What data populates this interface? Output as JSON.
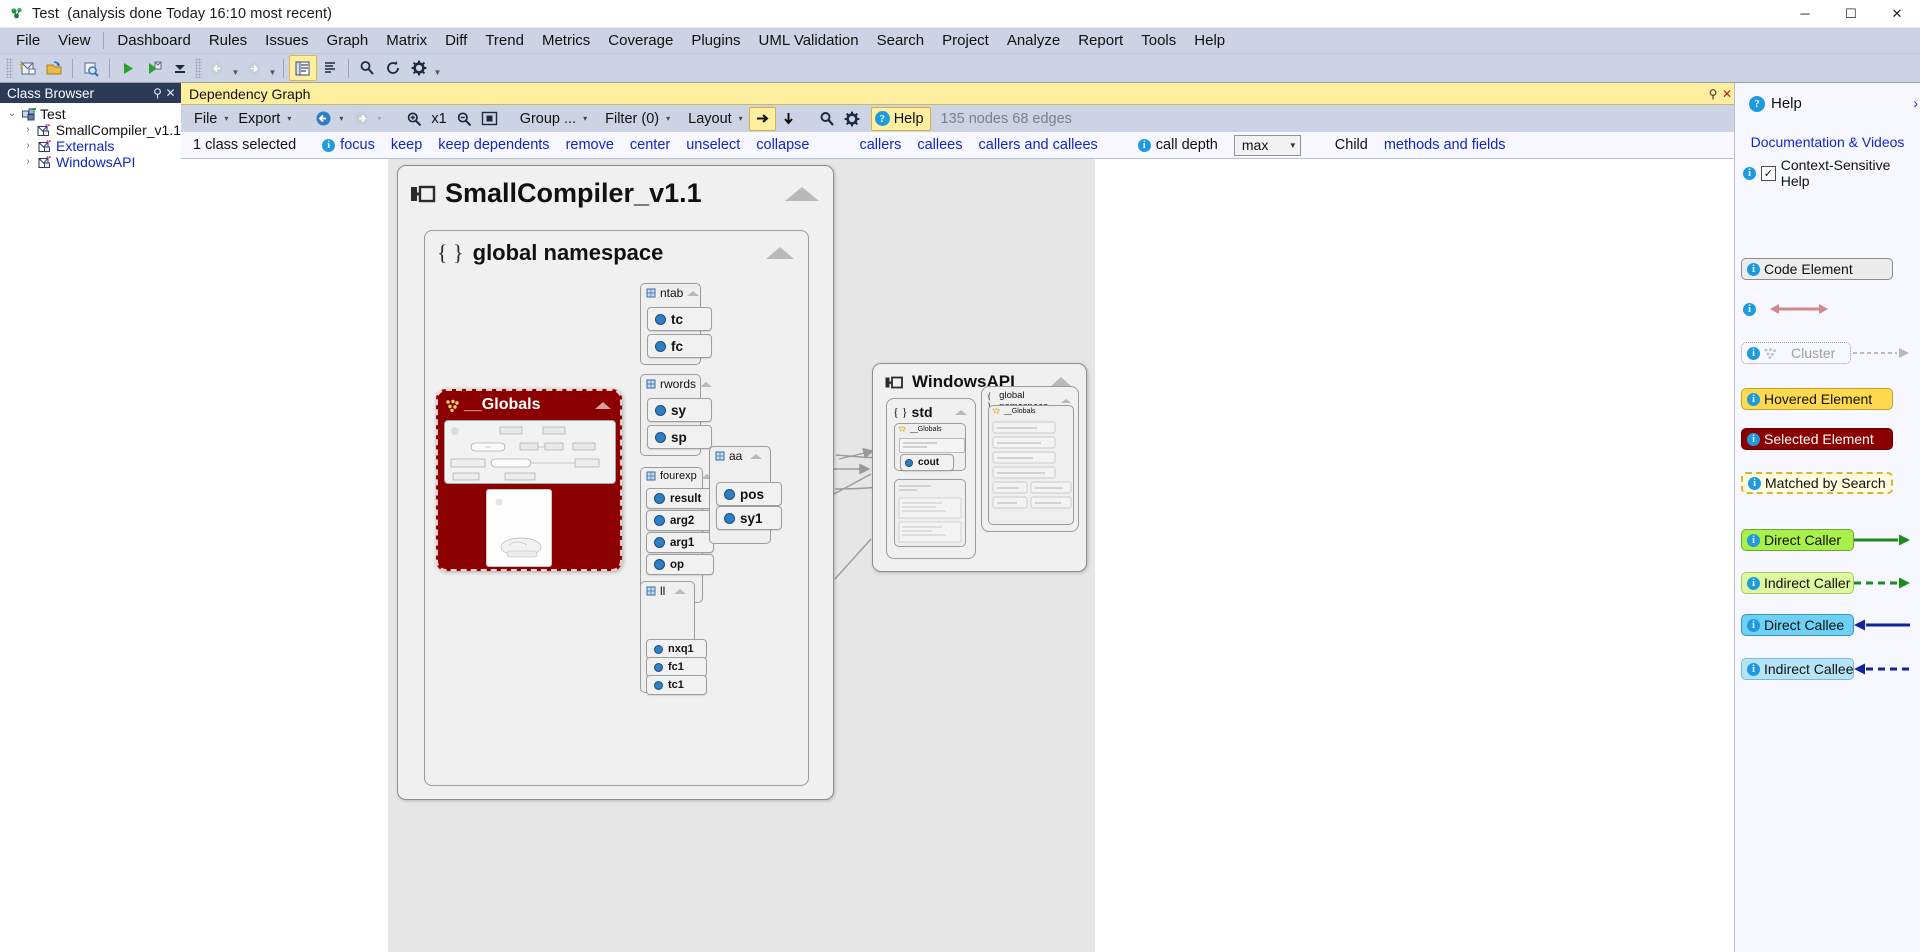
{
  "window": {
    "title_project": "Test",
    "title_detail": "(analysis done Today 16:10 most recent)",
    "app_icon": "ndepend-icon",
    "minimize_label": "─",
    "maximize_label": "☐",
    "close_label": "✕"
  },
  "menu": {
    "items": [
      {
        "label": "File"
      },
      {
        "label": "View"
      },
      {
        "label": "Dashboard"
      },
      {
        "label": "Rules"
      },
      {
        "label": "Issues"
      },
      {
        "label": "Graph"
      },
      {
        "label": "Matrix"
      },
      {
        "label": "Diff"
      },
      {
        "label": "Trend"
      },
      {
        "label": "Metrics"
      },
      {
        "label": "Coverage"
      },
      {
        "label": "Plugins"
      },
      {
        "label": "UML Validation"
      },
      {
        "label": "Search"
      },
      {
        "label": "Project"
      },
      {
        "label": "Analyze"
      },
      {
        "label": "Report"
      },
      {
        "label": "Tools"
      },
      {
        "label": "Help"
      }
    ]
  },
  "main_toolbar": {
    "buttons": [
      {
        "name": "new-project-icon"
      },
      {
        "name": "open-project-icon"
      },
      {
        "name": "save-icon"
      },
      {
        "name": "run-analysis-icon"
      },
      {
        "name": "run-analysis-report-icon"
      },
      {
        "name": "collapse-all-icon"
      },
      {
        "name": "undo-icon"
      },
      {
        "name": "redo-icon"
      },
      {
        "name": "class-browser-icon"
      },
      {
        "name": "list-icon"
      },
      {
        "name": "search-icon"
      },
      {
        "name": "refresh-icon"
      },
      {
        "name": "settings-icon"
      }
    ]
  },
  "class_browser": {
    "title": "Class Browser",
    "pin_icon": "pin-icon",
    "close_icon": "close-icon",
    "tree": [
      {
        "label": "Test",
        "expanded": true,
        "depth": 0,
        "icon": "project-icon",
        "link": false
      },
      {
        "label": "SmallCompiler_v1.1",
        "expanded": false,
        "depth": 1,
        "icon": "assembly-icon",
        "link": false
      },
      {
        "label": "Externals",
        "expanded": false,
        "depth": 1,
        "icon": "assembly-icon",
        "link": true
      },
      {
        "label": "WindowsAPI",
        "expanded": false,
        "depth": 1,
        "icon": "assembly-icon",
        "link": true
      }
    ]
  },
  "graph_tab": {
    "title": "Dependency Graph",
    "pin_icon": "pin-icon",
    "close_icon": "close-icon"
  },
  "graph_toolbar": {
    "file_label": "File",
    "export_label": "Export",
    "back_icon": "back-arrow-icon",
    "forward_icon": "forward-arrow-icon",
    "zoom_in_icon": "zoom-in-icon",
    "zoom_level": "x1",
    "zoom_out_icon": "zoom-out-icon",
    "fit_icon": "fit-to-screen-icon",
    "group_label": "Group ...",
    "filter_label": "Filter (0)",
    "layout_label": "Layout",
    "direction_right_icon": "arrow-right-icon",
    "direction_down_icon": "arrow-down-icon",
    "search_icon": "search-icon",
    "gear_icon": "gear-icon",
    "help_label": "Help",
    "stats": "135 nodes 68 edges"
  },
  "selection_bar": {
    "selection_text": "1 class selected",
    "actions": [
      {
        "label": "focus",
        "info": true
      },
      {
        "label": "keep",
        "info": false
      },
      {
        "label": "keep dependents",
        "info": false
      },
      {
        "label": "remove",
        "info": false
      },
      {
        "label": "center",
        "info": false
      },
      {
        "label": "unselect",
        "info": false
      },
      {
        "label": "collapse",
        "info": false
      }
    ],
    "call_actions": [
      {
        "label": "callers"
      },
      {
        "label": "callees"
      },
      {
        "label": "callers and callees"
      }
    ],
    "call_depth_label": "call depth",
    "call_depth_value": "max",
    "child_label": "Child",
    "child_link": "methods and fields"
  },
  "graph": {
    "assemblies": [
      {
        "name": "SmallCompiler_v1.1",
        "icon": "assembly-icon",
        "namespace": {
          "name": "global namespace",
          "icon": "namespace-icon"
        }
      },
      {
        "name": "WindowsAPI",
        "icon": "assembly-icon",
        "children": [
          {
            "name": "std",
            "icon": "namespace-icon"
          },
          {
            "name": "global namespace",
            "icon": "namespace-icon"
          }
        ]
      }
    ],
    "selected_class": {
      "name": "__Globals",
      "icon": "cluster-icon"
    },
    "classes": [
      {
        "name": "ntab",
        "icon": "class-icon",
        "members": [
          "tc",
          "fc"
        ]
      },
      {
        "name": "rwords",
        "icon": "class-icon",
        "members": [
          "sy",
          "sp"
        ]
      },
      {
        "name": "aa",
        "icon": "class-icon",
        "members": [
          "pos",
          "sy1"
        ]
      },
      {
        "name": "fourexp",
        "icon": "class-icon",
        "members": [
          "result",
          "arg2",
          "arg1",
          "op"
        ]
      },
      {
        "name": "ll",
        "icon": "class-icon",
        "members": [
          "nxq1",
          "fc1",
          "tc1"
        ]
      }
    ],
    "windows_api_members": {
      "std_globals": "__Globals",
      "std_member": "cout",
      "global_ns_class": "__Globals"
    }
  },
  "help_panel": {
    "title": "Help",
    "help_icon": "help-icon",
    "collapse_icon": "chevron-right-icon",
    "documentation_link": "Documentation & Videos",
    "context_sensitive_label": "Context-Sensitive Help",
    "context_sensitive_checked": true,
    "legend": [
      {
        "label": "Code Element",
        "style": "code",
        "arrow": "none"
      },
      {
        "label": "",
        "style": "none",
        "arrow": "bidirectional-pink"
      },
      {
        "label": "Cluster",
        "style": "cluster",
        "arrow": "dotted-grey"
      },
      {
        "label": "Hovered Element",
        "style": "hover",
        "arrow": "none"
      },
      {
        "label": "Selected Element",
        "style": "selected",
        "arrow": "none"
      },
      {
        "label": "Matched by Search",
        "style": "matched",
        "arrow": "none"
      },
      {
        "label": "Direct Caller",
        "style": "dcaller",
        "arrow": "solid-green-right"
      },
      {
        "label": "Indirect Caller",
        "style": "icaller",
        "arrow": "dashed-green-right"
      },
      {
        "label": "Direct Callee",
        "style": "dcallee",
        "arrow": "solid-blue-left"
      },
      {
        "label": "Indirect Callee",
        "style": "icallee",
        "arrow": "dashed-blue-left"
      }
    ]
  },
  "colors": {
    "menu_bg": "#ccd3e4",
    "tab_yellow": "#fdeea0",
    "panel_header": "#2b3a57",
    "link_blue": "#1026c8",
    "selected_red": "#8b0000",
    "info_blue": "#1e9be0"
  }
}
